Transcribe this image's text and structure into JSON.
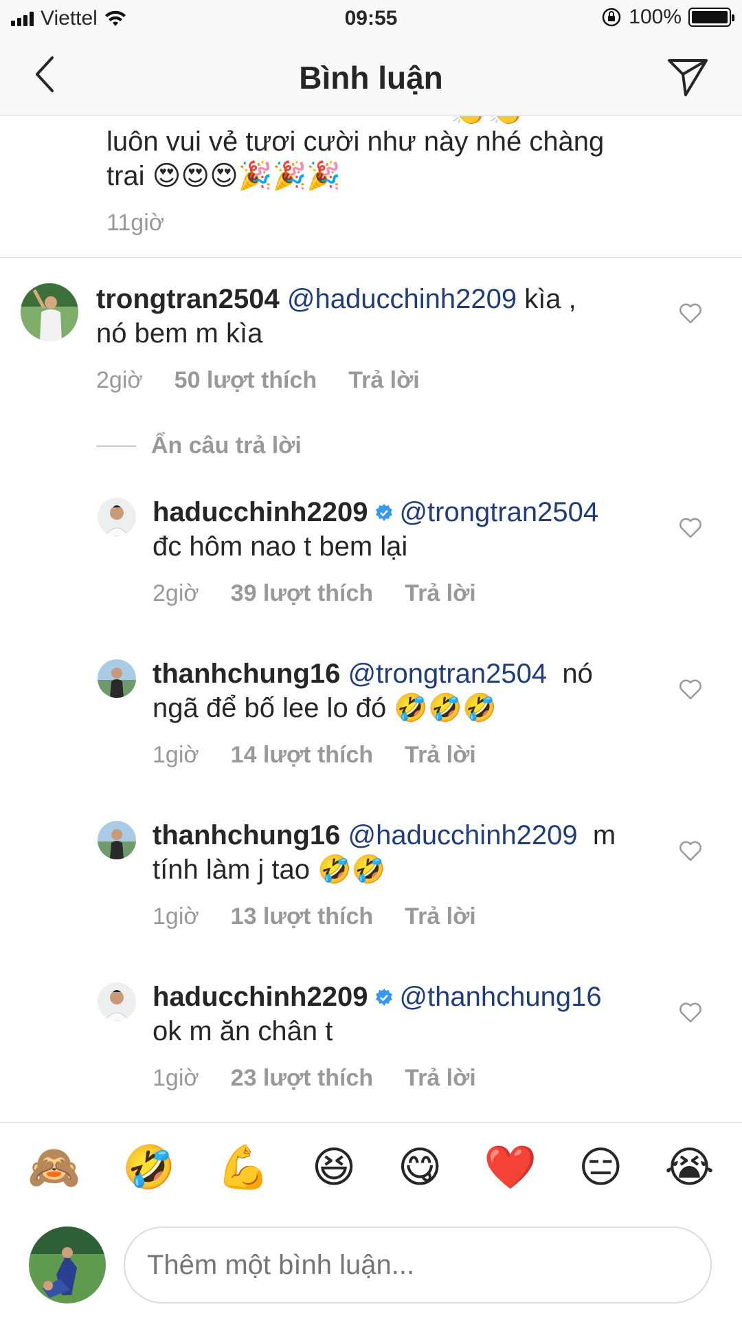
{
  "status_bar": {
    "carrier": "Viettel",
    "time": "09:55",
    "battery": "100%",
    "battery_level": 1.0
  },
  "header": {
    "title": "Bình luận",
    "back_icon": "chevron-left-icon",
    "send_icon": "paper-plane-icon"
  },
  "top_comment": {
    "text_line1": "luôn vui vẻ tươi cười như này nhé chàng",
    "text_line2": "trai 😍😍😍🎉🎉🎉",
    "clipped_emoji": "👏👏",
    "time": "11giờ"
  },
  "parent_comment": {
    "username": "trongtran2504",
    "mention": "@haducchinh2209",
    "text_line1_rest": " kìa ,",
    "text_line2": "nó bem m kìa",
    "time": "2giờ",
    "likes": "50 lượt thích",
    "reply": "Trả lời"
  },
  "hide_replies": "Ẩn câu trả lời",
  "replies": [
    {
      "username": "haducchinh2209",
      "verified": true,
      "mention": "@trongtran2504",
      "line1_rest": "",
      "line2": "đc hôm nao t bem lại",
      "time": "2giờ",
      "likes": "39 lượt thích",
      "reply": "Trả lời"
    },
    {
      "username": "thanhchung16",
      "verified": false,
      "mention": "@trongtran2504",
      "line1_rest": "  nó",
      "line2": "ngã để bố lee lo đó 🤣🤣🤣",
      "time": "1giờ",
      "likes": "14 lượt thích",
      "reply": "Trả lời"
    },
    {
      "username": "thanhchung16",
      "verified": false,
      "mention": "@haducchinh2209",
      "line1_rest": "  m",
      "line2": "tính làm j tao 🤣🤣",
      "time": "1giờ",
      "likes": "13 lượt thích",
      "reply": "Trả lời"
    },
    {
      "username": "haducchinh2209",
      "verified": true,
      "mention": "@thanhchung16",
      "line1_rest": "",
      "line2": "ok m ăn chân t",
      "time": "1giờ",
      "likes": "23 lượt thích",
      "reply": "Trả lời"
    }
  ],
  "emoji_bar": [
    "🙈",
    "🤣",
    "💪",
    "😆",
    "😋",
    "❤️",
    "😑",
    "😭"
  ],
  "input": {
    "placeholder": "Thêm một bình luận..."
  },
  "colors": {
    "mention": "#1f3d7a",
    "verified": "#3897f0",
    "meta_gray": "#999999"
  }
}
